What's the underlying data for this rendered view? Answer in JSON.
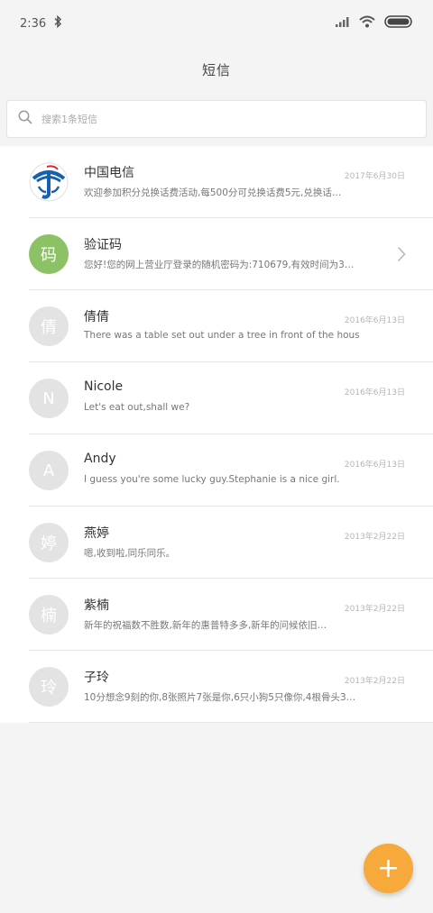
{
  "status_bar": {
    "time": "2:36",
    "icons": [
      "bluetooth-icon",
      "signal-icon",
      "wifi-icon",
      "battery-icon"
    ]
  },
  "header": {
    "title": "短信"
  },
  "search": {
    "placeholder": "搜索1条短信",
    "value": ""
  },
  "threads": [
    {
      "avatar_text": "",
      "avatar_type": "telecom-logo",
      "name": "中国电信",
      "preview": "欢迎参加积分兑换话费活动,每500分可兑换话费5元,兑换话…",
      "date": "2017年6月30日"
    },
    {
      "avatar_text": "码",
      "avatar_type": "green",
      "name": "验证码",
      "preview": "您好!您的网上营业厅登录的随机密码为:710679,有效时间为3…",
      "date": ""
    },
    {
      "avatar_text": "倩",
      "avatar_type": "gray",
      "name": "倩倩",
      "preview": "There was a table set out under a tree in front of the hous",
      "date": "2016年6月13日"
    },
    {
      "avatar_text": "N",
      "avatar_type": "gray",
      "name": "Nicole",
      "preview": "Let's eat out,shall we?",
      "date": "2016年6月13日"
    },
    {
      "avatar_text": "A",
      "avatar_type": "gray",
      "name": "Andy",
      "preview": "I guess you're some lucky guy.Stephanie is a nice girl.",
      "date": "2016年6月13日"
    },
    {
      "avatar_text": "婷",
      "avatar_type": "gray",
      "name": "燕婷",
      "preview": "嗯,收到啦,同乐同乐。",
      "date": "2013年2月22日"
    },
    {
      "avatar_text": "楠",
      "avatar_type": "gray",
      "name": "紫楠",
      "preview": "新年的祝福数不胜数,新年的惠普特多多,新年的问候依旧…",
      "date": "2013年2月22日"
    },
    {
      "avatar_text": "玲",
      "avatar_type": "gray",
      "name": "子玲",
      "preview": "10分想念9刻的你,8张照片7张是你,6只小狗5只像你,4根骨头3…",
      "date": "2013年2月22日"
    }
  ],
  "fab": {
    "label": "+"
  },
  "colors": {
    "accent": "#f7a93b",
    "green_avatar": "#8cc265",
    "gray_avatar": "#e3e3e3",
    "telecom_blue": "#1560b0"
  }
}
